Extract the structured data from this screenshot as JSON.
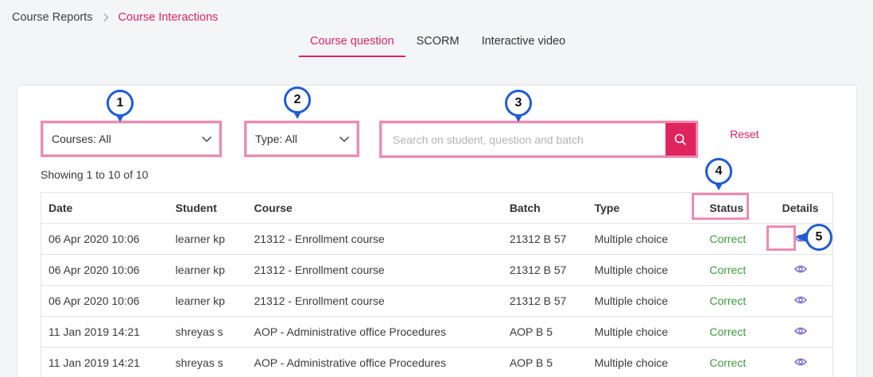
{
  "breadcrumb": {
    "home": "Course Reports",
    "current": "Course Interactions"
  },
  "tabs": [
    {
      "label": "Course question",
      "active": true
    },
    {
      "label": "SCORM",
      "active": false
    },
    {
      "label": "Interactive video",
      "active": false
    }
  ],
  "filters": {
    "courses": "Courses: All",
    "type": "Type: All",
    "search_placeholder": "Search on student, question and batch",
    "reset": "Reset"
  },
  "showing": "Showing 1 to 10 of 10",
  "table": {
    "headers": [
      "Date",
      "Student",
      "Course",
      "Batch",
      "Type",
      "Status",
      "Details"
    ],
    "rows": [
      {
        "date": "06 Apr 2020 10:06",
        "student": "learner kp",
        "course": "21312 - Enrollment course",
        "batch": "21312 B 57",
        "type": "Multiple choice",
        "status": "Correct"
      },
      {
        "date": "06 Apr 2020 10:06",
        "student": "learner kp",
        "course": "21312 - Enrollment course",
        "batch": "21312 B 57",
        "type": "Multiple choice",
        "status": "Correct"
      },
      {
        "date": "06 Apr 2020 10:06",
        "student": "learner kp",
        "course": "21312 - Enrollment course",
        "batch": "21312 B 57",
        "type": "Multiple choice",
        "status": "Correct"
      },
      {
        "date": "11 Jan 2019 14:21",
        "student": "shreyas s",
        "course": "AOP - Administrative office Procedures",
        "batch": "AOP B 5",
        "type": "Multiple choice",
        "status": "Correct"
      },
      {
        "date": "11 Jan 2019 14:21",
        "student": "shreyas s",
        "course": "AOP - Administrative office Procedures",
        "batch": "AOP B 5",
        "type": "Multiple choice",
        "status": "Correct"
      }
    ]
  },
  "callouts": [
    "1",
    "2",
    "3",
    "4",
    "5"
  ],
  "colors": {
    "accent": "#e0245e",
    "highlight": "#f08ab2",
    "callout": "#1f5bd6",
    "correct": "#3c9a3c",
    "eye": "#6a5acd"
  },
  "icons": {
    "search": "search-icon",
    "eye": "eye-icon",
    "caret": "chevron-down-icon",
    "separator": "chevron-right-icon"
  }
}
